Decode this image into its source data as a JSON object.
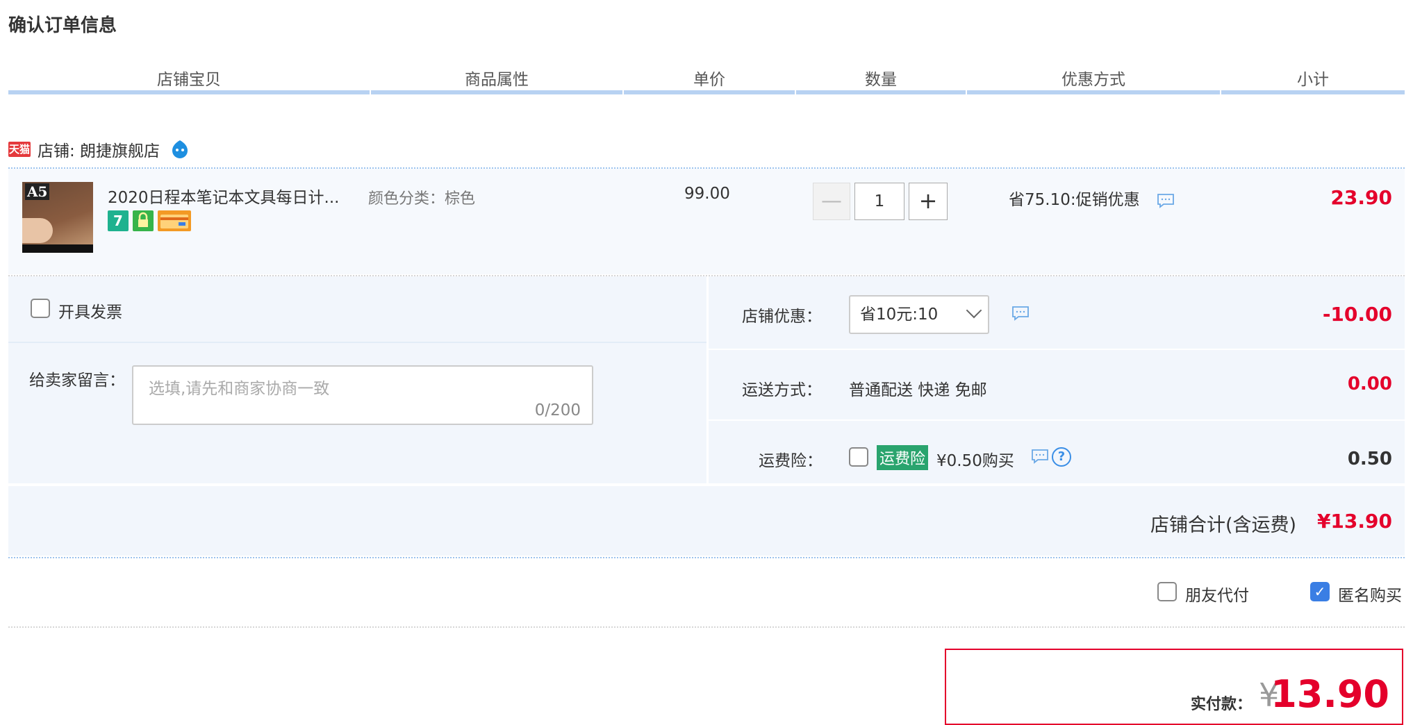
{
  "page": {
    "title": "确认订单信息"
  },
  "columns": [
    "店铺宝贝",
    "商品属性",
    "单价",
    "数量",
    "优惠方式",
    "小计"
  ],
  "shop": {
    "badge": "天猫",
    "label": "店铺: 朗捷旗舰店",
    "chat_icon": "wangwang-icon"
  },
  "item": {
    "thumb_text": "A5",
    "title": "2020日程本笔记本文具每日计...",
    "service_icons": [
      "seven-day-return-icon",
      "guarantee-icon",
      "credit-card-icon"
    ],
    "attribute": "颜色分类：棕色",
    "unit_price": "99.00",
    "quantity": "1",
    "minus": "—",
    "plus": "+",
    "promo": "省75.10:促销优惠",
    "subtotal": "23.90"
  },
  "invoice": {
    "label": "开具发票",
    "checked": false
  },
  "message": {
    "label": "给卖家留言：",
    "placeholder": "选填,请先和商家协商一致",
    "count": "0/200"
  },
  "shop_coupon": {
    "label": "店铺优惠：",
    "selected": "省10元:10",
    "amount": "-10.00"
  },
  "shipping": {
    "label": "运送方式：",
    "value": "普通配送 快递 免邮",
    "amount": "0.00"
  },
  "insurance": {
    "label": "运费险：",
    "badge": "运费险",
    "text": "¥0.50购买",
    "amount": "0.50",
    "checked": false
  },
  "shop_total": {
    "label": "店铺合计(含运费)",
    "amount": "¥13.90"
  },
  "options": {
    "friend_pay": "朋友代付",
    "friend_pay_checked": false,
    "anonymous": "匿名购买",
    "anonymous_checked": true
  },
  "payment": {
    "label": "实付款：",
    "currency": "¥",
    "amount": "13.90"
  },
  "colors": {
    "accent_red": "#e4002b",
    "header_line": "#b8d2f2",
    "panel_bg": "#f2f6fc",
    "check_blue": "#3a7ee4"
  }
}
